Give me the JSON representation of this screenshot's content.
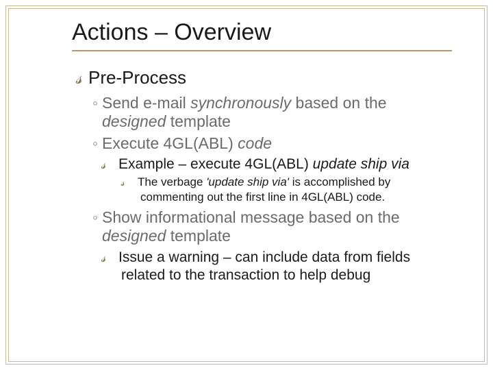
{
  "title": "Actions – Overview",
  "bullets": {
    "preprocess": "Pre-Process",
    "send_a": "Send e-mail ",
    "send_b": "synchronously",
    "send_c": " based on the ",
    "send_d": "designed",
    "send_e": " template",
    "exec_a": "Execute 4GL(ABL) ",
    "exec_b": "code",
    "example_a": "Example – execute 4GL(ABL) ",
    "example_b": "update ship via",
    "verbage_a": "The verbage ",
    "verbage_b": "'update ship via'",
    "verbage_c": " is accomplished by commenting out the first line in 4GL(ABL) code.",
    "show_a": "Show informational message based on the ",
    "show_b": "designed",
    "show_c": " template",
    "issue": "Issue a warning – can include data from fields related to the transaction to help debug"
  }
}
